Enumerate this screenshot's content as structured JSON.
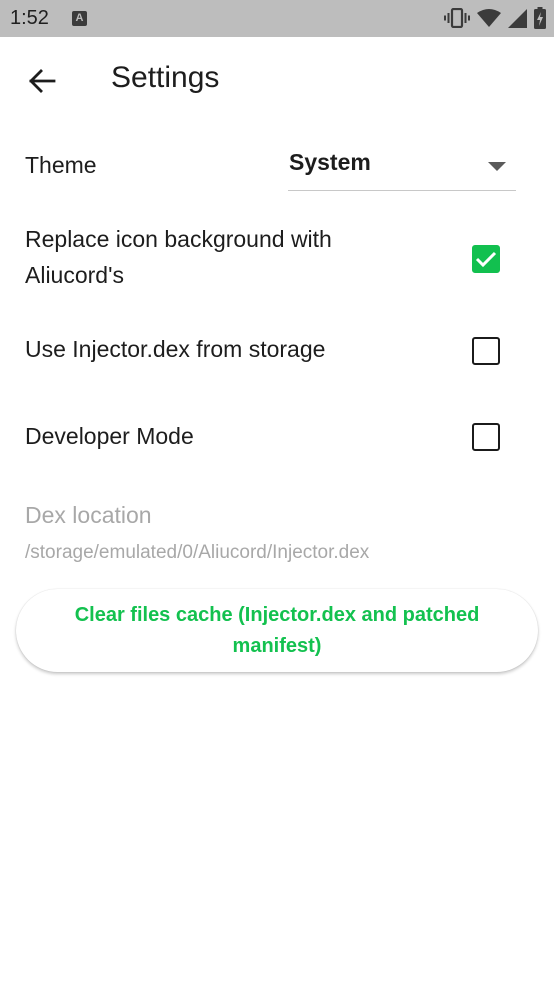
{
  "status_bar": {
    "time": "1:52",
    "icons": [
      "a-notification-icon",
      "vibrate-icon",
      "wifi-icon",
      "signal-icon",
      "battery-charging-icon"
    ]
  },
  "app_bar": {
    "title": "Settings",
    "back_icon": "arrow-back-icon"
  },
  "settings": {
    "theme": {
      "label": "Theme",
      "value": "System"
    },
    "replace_icon_background": {
      "label": "Replace icon background with Aliucord's",
      "checked": true
    },
    "use_injector_dex": {
      "label": "Use Injector.dex from storage",
      "checked": false
    },
    "developer_mode": {
      "label": "Developer Mode",
      "checked": false
    },
    "dex_location": {
      "label": "Dex location",
      "placeholder": "/storage/emulated/0/Aliucord/Injector.dex"
    },
    "clear_cache_button": {
      "label": "Clear files cache (Injector.dex and patched manifest)"
    }
  },
  "colors": {
    "accent": "#12c04f",
    "status_bar": "#bdbdbd",
    "muted_text": "#a8a8a8"
  }
}
